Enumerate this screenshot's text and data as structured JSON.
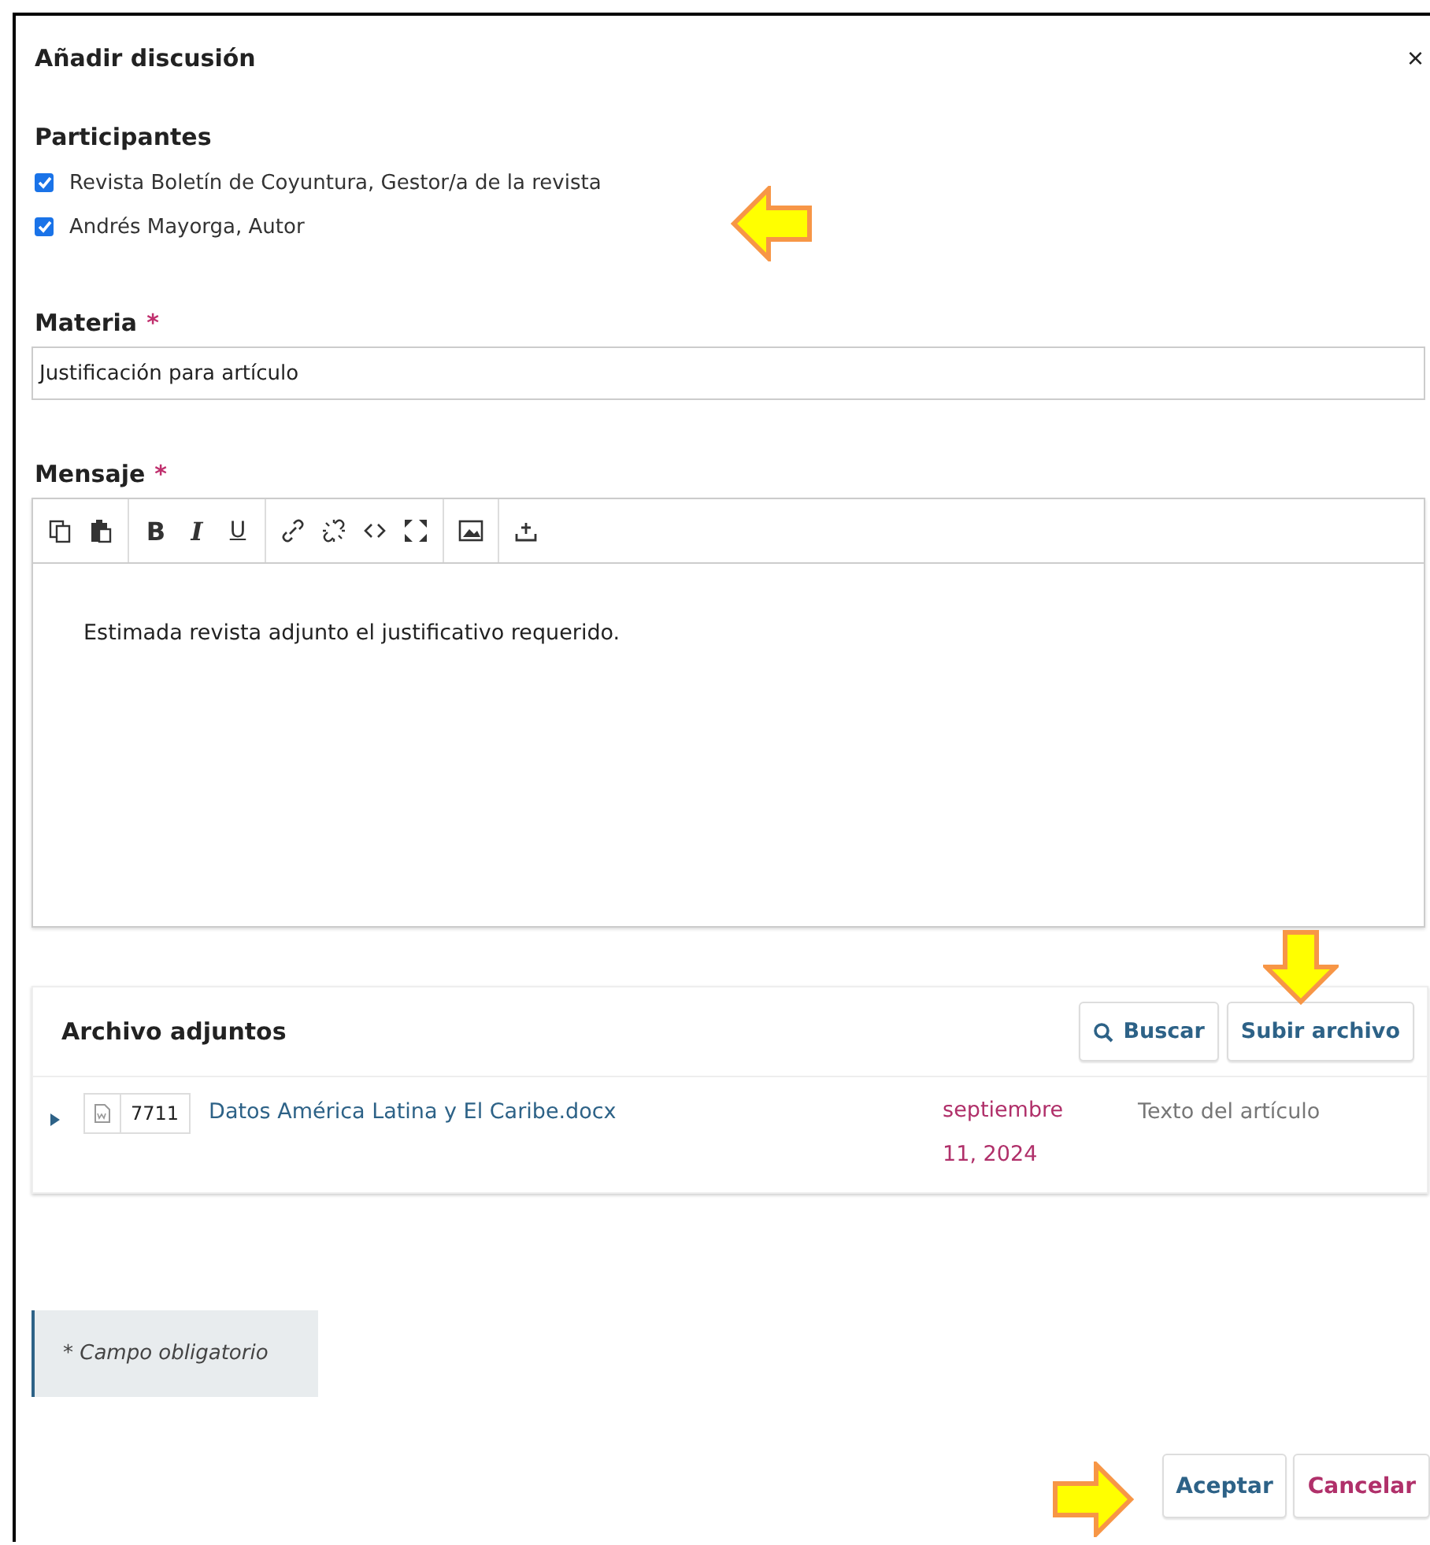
{
  "dialog": {
    "title": "Añadir discusión",
    "close": "×"
  },
  "participants": {
    "heading": "Participantes",
    "items": [
      {
        "label": "Revista Boletín de Coyuntura, Gestor/a de la revista",
        "checked": true
      },
      {
        "label": "Andrés Mayorga, Autor",
        "checked": true
      }
    ]
  },
  "subject": {
    "label": "Materia",
    "required_mark": "*",
    "value": "Justificación para artículo"
  },
  "message": {
    "label": "Mensaje",
    "required_mark": "*",
    "toolbar": [
      [
        {
          "kind": "copy"
        },
        {
          "kind": "paste"
        }
      ],
      [
        {
          "kind": "bold",
          "text": "B"
        },
        {
          "kind": "italic",
          "text": "I"
        },
        {
          "kind": "underline",
          "text": "U"
        }
      ],
      [
        {
          "kind": "link"
        },
        {
          "kind": "unlink"
        },
        {
          "kind": "code"
        },
        {
          "kind": "fullscreen"
        }
      ],
      [
        {
          "kind": "image"
        }
      ],
      [
        {
          "kind": "upload"
        }
      ]
    ],
    "body": "Estimada revista adjunto el justificativo requerido."
  },
  "attachments": {
    "title": "Archivo adjuntos",
    "actions": [
      {
        "kind": "search",
        "label": "Buscar"
      },
      {
        "kind": "upload",
        "label": "Subir archivo"
      }
    ],
    "files": [
      {
        "id": "7711",
        "name": "Datos América Latina y El Caribe.docx",
        "date_lines": [
          "septiembre",
          "11, 2024"
        ],
        "type": "Texto del artículo",
        "expanded": false
      }
    ]
  },
  "required_note": "* Campo obligatorio",
  "buttons": [
    {
      "kind": "primary",
      "label": "Aceptar"
    },
    {
      "kind": "cancel",
      "label": "Cancelar"
    }
  ],
  "annotations": [
    {
      "kind": "left"
    },
    {
      "kind": "down"
    },
    {
      "kind": "right"
    }
  ]
}
